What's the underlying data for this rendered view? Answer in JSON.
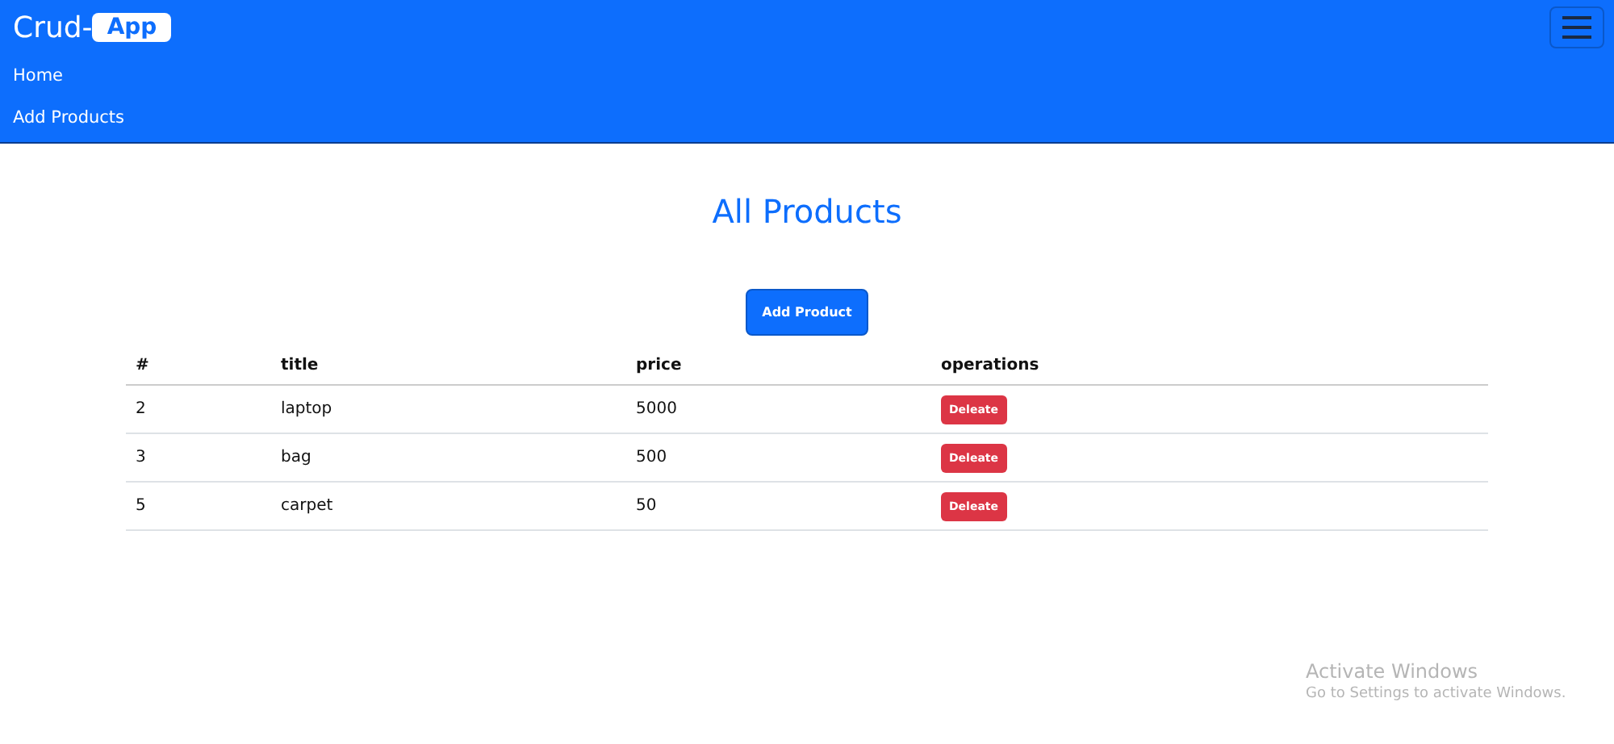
{
  "navbar": {
    "brand": "Crud-",
    "brand_badge": "App",
    "links": [
      {
        "label": "Home"
      },
      {
        "label": "Add Products"
      }
    ]
  },
  "heading": "All Products",
  "add_button": "Add Product",
  "table": {
    "columns": [
      "#",
      "title",
      "price",
      "operations"
    ],
    "rows": [
      {
        "id": "2",
        "title": "laptop",
        "price": "5000",
        "action": "Deleate"
      },
      {
        "id": "3",
        "title": "bag",
        "price": "500",
        "action": "Deleate"
      },
      {
        "id": "5",
        "title": "carpet",
        "price": "50",
        "action": "Deleate"
      }
    ]
  },
  "os_notice": {
    "title": "Activate Windows",
    "text": "Go to Settings to activate Windows."
  }
}
